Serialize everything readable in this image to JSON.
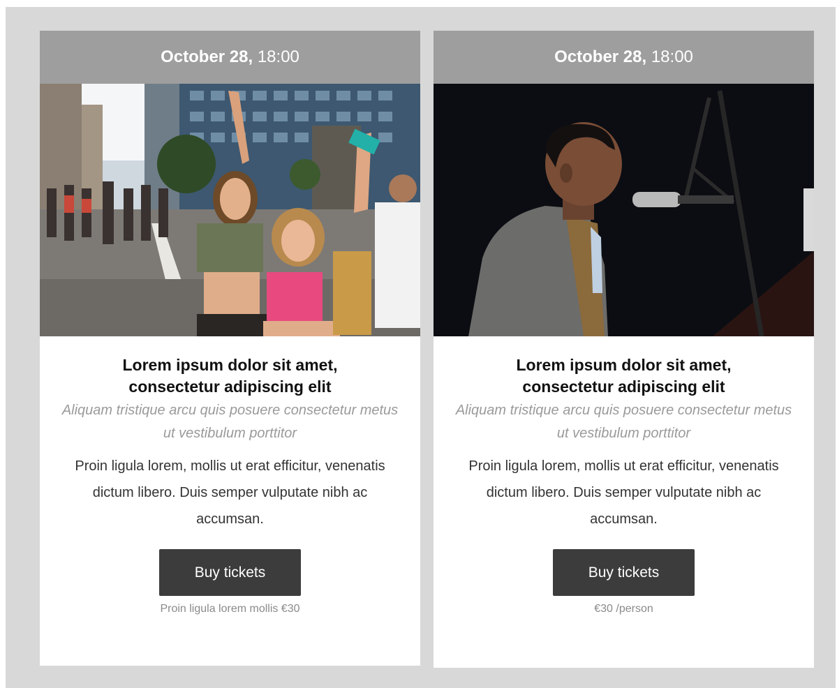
{
  "events": [
    {
      "date": "October 28,",
      "time": "18:00",
      "image_alt": "Crowd of people cheering in a city street",
      "title": "Lorem ipsum dolor sit amet, consectetur adipiscing elit",
      "subtitle": "Aliquam tristique arcu quis posuere consectetur metus ut vestibulum porttitor",
      "body": "Proin ligula lorem, mollis ut erat efficitur, venenatis dictum libero. Duis semper vulputate nibh ac accumsan.",
      "button_label": "Buy tickets",
      "price_note": "Proin ligula lorem mollis €30"
    },
    {
      "date": "October 28,",
      "time": "18:00",
      "image_alt": "Singer performing at a microphone on a dark stage",
      "title": "Lorem ipsum dolor sit amet, consectetur adipiscing elit",
      "subtitle": "Aliquam tristique arcu quis posuere consectetur metus ut vestibulum porttitor",
      "body": "Proin ligula lorem, mollis ut erat efficitur, venenatis dictum libero. Duis semper vulputate nibh ac accumsan.",
      "button_label": "Buy tickets",
      "price_note": "€30 /person"
    }
  ],
  "colors": {
    "page_background": "#d8d8d8",
    "card_header": "#9e9e9e",
    "button": "#3c3c3c",
    "subtitle": "#9a9a9a"
  }
}
